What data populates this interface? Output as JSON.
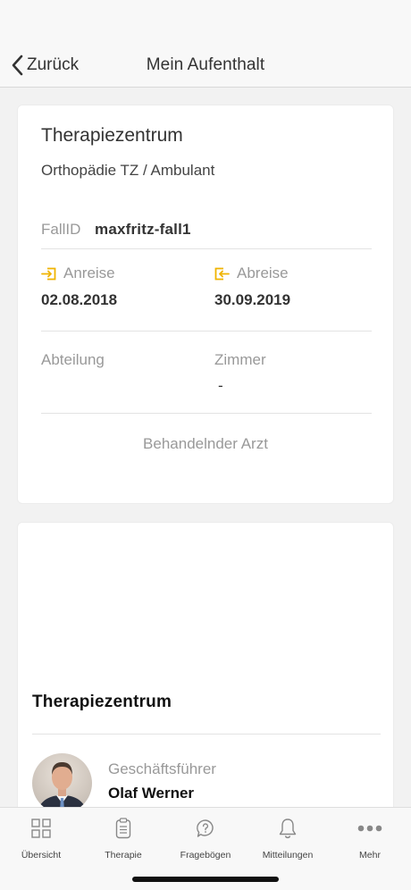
{
  "nav": {
    "back_label": "Zurück",
    "title": "Mein Aufenthalt"
  },
  "stay": {
    "title": "Therapiezentrum",
    "subtitle": "Orthopädie TZ / Ambulant",
    "fall_label": "FallID",
    "fall_value": "maxfritz-fall1",
    "arrival_label": "Anreise",
    "arrival_value": "02.08.2018",
    "departure_label": "Abreise",
    "departure_value": "30.09.2019",
    "department_label": "Abteilung",
    "department_value": "",
    "room_label": "Zimmer",
    "room_value": "-",
    "doctor_label": "Behandelnder Arzt"
  },
  "facility": {
    "title": "Therapiezentrum",
    "person_role": "Geschäftsführer",
    "person_name": "Olaf Werner"
  },
  "tabs": [
    {
      "label": "Übersicht",
      "icon": "grid-icon"
    },
    {
      "label": "Therapie",
      "icon": "clipboard-icon"
    },
    {
      "label": "Fragebögen",
      "icon": "question-bubble-icon"
    },
    {
      "label": "Mitteilungen",
      "icon": "bell-icon"
    },
    {
      "label": "Mehr",
      "icon": "more-dots-icon"
    }
  ],
  "colors": {
    "accent": "#f0b400",
    "text": "#333333",
    "muted": "#999999",
    "background": "#f2f2f2"
  }
}
